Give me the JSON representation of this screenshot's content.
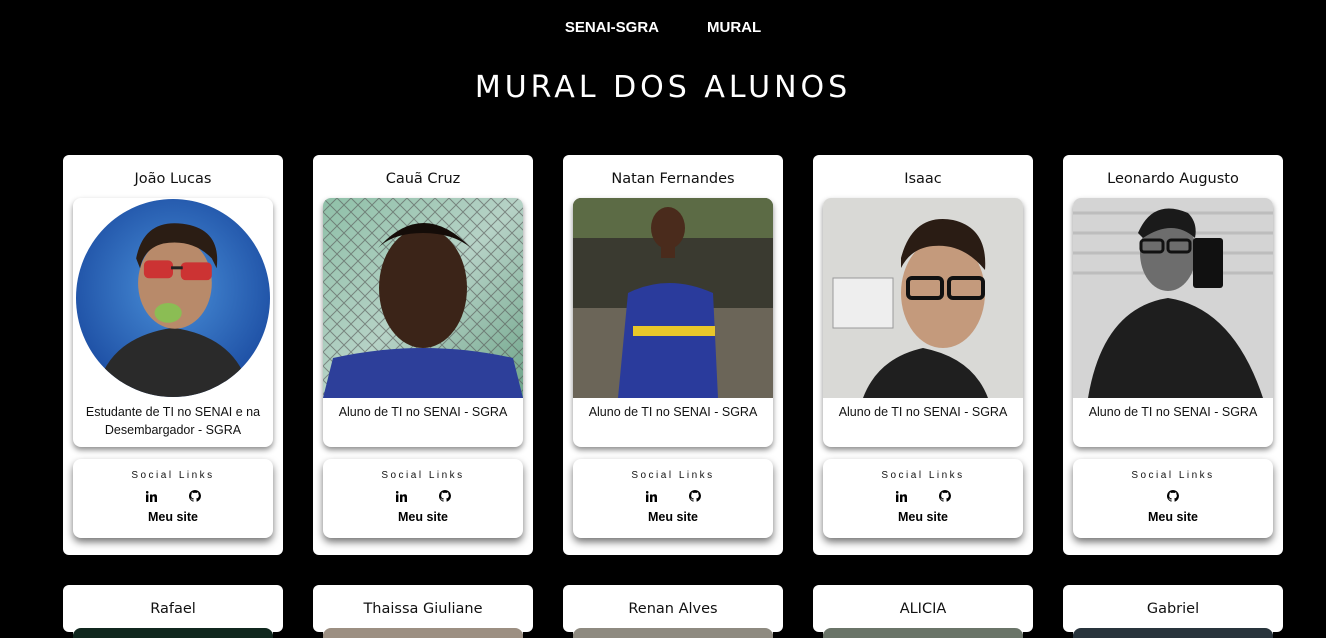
{
  "nav": {
    "items": [
      {
        "label": "SENAI-SGRA"
      },
      {
        "label": "MURAL"
      }
    ]
  },
  "page": {
    "title": "MURAL DOS ALUNOS"
  },
  "cards": [
    {
      "name": "João Lucas",
      "description": "Estudante de TI no SENAI e na Desembargador - SGRA",
      "social_title": "Social Links",
      "site_label": "Meu site",
      "icons": [
        "linkedin-icon",
        "github-icon"
      ]
    },
    {
      "name": "Cauã Cruz",
      "description": "Aluno de TI no SENAI - SGRA",
      "social_title": "Social Links",
      "site_label": "Meu site",
      "icons": [
        "linkedin-icon",
        "github-icon"
      ]
    },
    {
      "name": "Natan Fernandes",
      "description": "Aluno de TI no SENAI - SGRA",
      "social_title": "Social Links",
      "site_label": "Meu site",
      "icons": [
        "linkedin-icon",
        "github-icon"
      ]
    },
    {
      "name": "Isaac",
      "description": "Aluno de TI no SENAI - SGRA",
      "social_title": "Social Links",
      "site_label": "Meu site",
      "icons": [
        "linkedin-icon",
        "github-icon"
      ]
    },
    {
      "name": "Leonardo Augusto",
      "description": "Aluno de TI no SENAI - SGRA",
      "social_title": "Social Links",
      "site_label": "Meu site",
      "icons": [
        "github-icon"
      ]
    }
  ],
  "cards_row2": [
    {
      "name": "Rafael"
    },
    {
      "name": "Thaissa Giuliane"
    },
    {
      "name": "Renan Alves"
    },
    {
      "name": "ALICIA"
    },
    {
      "name": "Gabriel"
    }
  ],
  "colors": {
    "background": "#000000",
    "card": "#ffffff",
    "text": "#111111"
  }
}
